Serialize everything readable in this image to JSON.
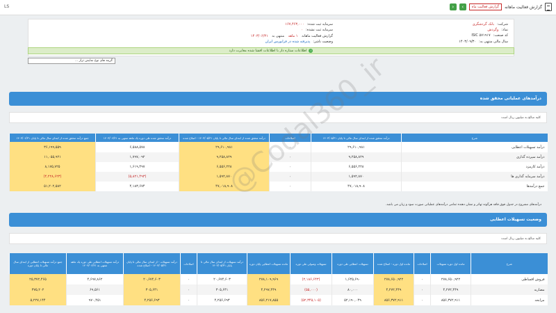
{
  "topbar": {
    "left_text": "LS",
    "title": "گزارش فعالیت ماهانه",
    "badge": "گزارش فعالیت ماه",
    "prev": "‹",
    "next": "›"
  },
  "info": {
    "company_label": "شرکت:",
    "company_value": "بانک گردشگری",
    "symbol_label": "نماد:",
    "symbol_value": "وگردش",
    "code_label": "کد صنعت:",
    "code_value": "ISIC ۵۷۱۹۱۷",
    "year_label": "سال مالی منتهی به:",
    "year_value": "۱۴۰۳/۰۹/۳۰",
    "capital_label": "سرمایه ثبت شده:",
    "capital_value": "۱۶۷,۴۶۳,۰۰۰",
    "unreg_capital_label": "سرمایه ثبت نشده:",
    "unreg_capital_value": "۰",
    "report_label": "گزارش فعالیت ماهانه",
    "period_label": "۱ ماهه",
    "period_end_label": "منتهی به",
    "period_end_value": "۱۴۰۳/۰۶/۳۱",
    "status_label": "وضعیت ناشر:",
    "status_value": "پذیرفته شده در فرابورس ایران"
  },
  "notice": "اطلاعات ستاره دار با اطلاعات افشا شده مغایرت دارد",
  "select_value": "گزینه های نوع نمایش تراز ...",
  "section1": {
    "title": "درآمدهای عملیاتی محقق شده",
    "note": "کلیه مبالغ به میلیون ریال است",
    "headers": [
      "شرح",
      "درآمد محقق شده از ابتدای سال مالی تا پایان ۱۴۰۳/۰۵/۳۱",
      "اصلاحات",
      "درآمد محقق شده از ابتدای سال مالی تا پایان ۱۴۰۳/۰۵/۳۱ - اصلاح شده",
      "درآمد محقق شده طی دوره یک ماهه منتهی به ۱۴۰۳/۰۶/۳۱",
      "جمع درآمد محقق شده از ابتدای سال مالی تا پایان ۱۴۰۳/۰۶/۳۱"
    ],
    "rows": [
      [
        "درآمد تسهیلات اعطایی",
        "۲۹,۶۱۰,۹۸۱",
        "۰",
        "۲۹,۶۱۰,۹۸۱",
        "۶,۵۸۸,۵۷۸",
        "۳۶,۱۹۹,۵۵۹"
      ],
      [
        "درآمد سپرده گذاری",
        "۹,۲۵۸,۸۲۹",
        "۰",
        "۹,۲۵۸,۸۲۹",
        "۱,۷۹۷,۰۹۲",
        "۱۱,۰۵۵,۹۲۱"
      ],
      [
        "درآمد کارمزد",
        "۶,۵۵۶,۲۲۸",
        "۰",
        "۶,۵۵۶,۲۲۸",
        "۱,۶۱۹,۴۹۷",
        "۸,۱۷۵,۷۲۵"
      ],
      [
        "درآمد سرمایه گذاری ها",
        "۱,۵۹۲,۸۷۰",
        "۰",
        "۱,۵۹۲,۸۷۰",
        "(۵,۸۲۱,۴۹۳)",
        "(۴,۲۲۸,۶۲۳)"
      ],
      [
        "جمع درآمدها",
        "۴۷,۰۱۸,۹۰۸",
        "۰",
        "۴۷,۰۱۸,۹۰۸",
        "۴,۱۸۳,۶۷۴",
        "۵۱,۲۰۲,۵۸۲"
      ]
    ],
    "footnote": "درآمدهای مشروح در جدول فوق فاقد هرگونه تهاتر و نشان دهنده تمامی درآمدهای عملیاتی صورت سود و زیان می باشد."
  },
  "section2": {
    "title": "وضعیت تسهیلات اعطایی",
    "note": "کلیه مبالغ به میلیون ریال است",
    "headers": [
      "شرح",
      "مانده اول دوره تسهیلات",
      "اصلاحات",
      "مانده اول دوره - اصلاح شده",
      "تسهیلات اعطایی طی دوره",
      "تسهیلات وصولی طی دوره",
      "مانده تسهیلات اعطایی پایان دوره",
      "درآمد تسهیلات از ابتدای سال مالی تا پایان ۱۴۰۳/۰۵/۳۱",
      "اصلاحات",
      "درآمد تسهیلات - از ابتدای سال مالی تا پایان ۱۴۰۳/۰۵/۳۱ - اصلاح شده",
      "درآمد تسهیلات اعطایی طی دوره یک ماهه منتهی به ۱۴۰۳/۰۶/۳۱",
      "جمع درآمد تسهیلات اعطایی از ابتدای سال مالی تا پایان دوره"
    ],
    "rows": [
      [
        "فروش اقساطی",
        "۲۷۸,۶۵۰,۹۲۲",
        "۰",
        "۲۷۸,۶۵۰,۹۲۲",
        "۱,۶۴۵,۶۹۰",
        "(۲,۱۸۶,۶۴۳)",
        "۲۷۸,۱۰۹,۹۶۹",
        "۲۰,۶۷۴,۶۰۳",
        "۰",
        "۲۰,۶۷۴,۶۰۳",
        "۴,۶۹۷,۸۶۲",
        "۲۵,۳۷۲,۴۶۵"
      ],
      [
        "مضاربه",
        "۴,۲۷۲,۴۴۹",
        "۰",
        "۴,۲۷۲,۴۴۹",
        "۸۰,۰۰۰",
        "(۵۵,۰۰۰)",
        "۴,۲۹۷,۴۴۹",
        "۳۰۵,۶۴۱",
        "۰",
        "۳۰۵,۶۴۱",
        "۶۹,۵۶۱",
        "۳۷۵,۲۰۲"
      ],
      [
        "مرابحه",
        "۸۵۶,۳۷۲,۹۱۱",
        "۰",
        "۸۵۶,۳۷۲,۹۱۱",
        "۵۲,۱۹۰,۰۴۹",
        "(۵۲,۳۴۵,۱۰۵)",
        "۸۵۶,۲۱۷,۸۵۵",
        "۴,۲۵۶,۶۹۳",
        "۰",
        "۴,۲۵۶,۶۹۳",
        "۹۷۰,۴۵۱",
        "۵,۲۲۷,۱۴۴"
      ]
    ]
  },
  "watermark": "@Codal360_ir"
}
